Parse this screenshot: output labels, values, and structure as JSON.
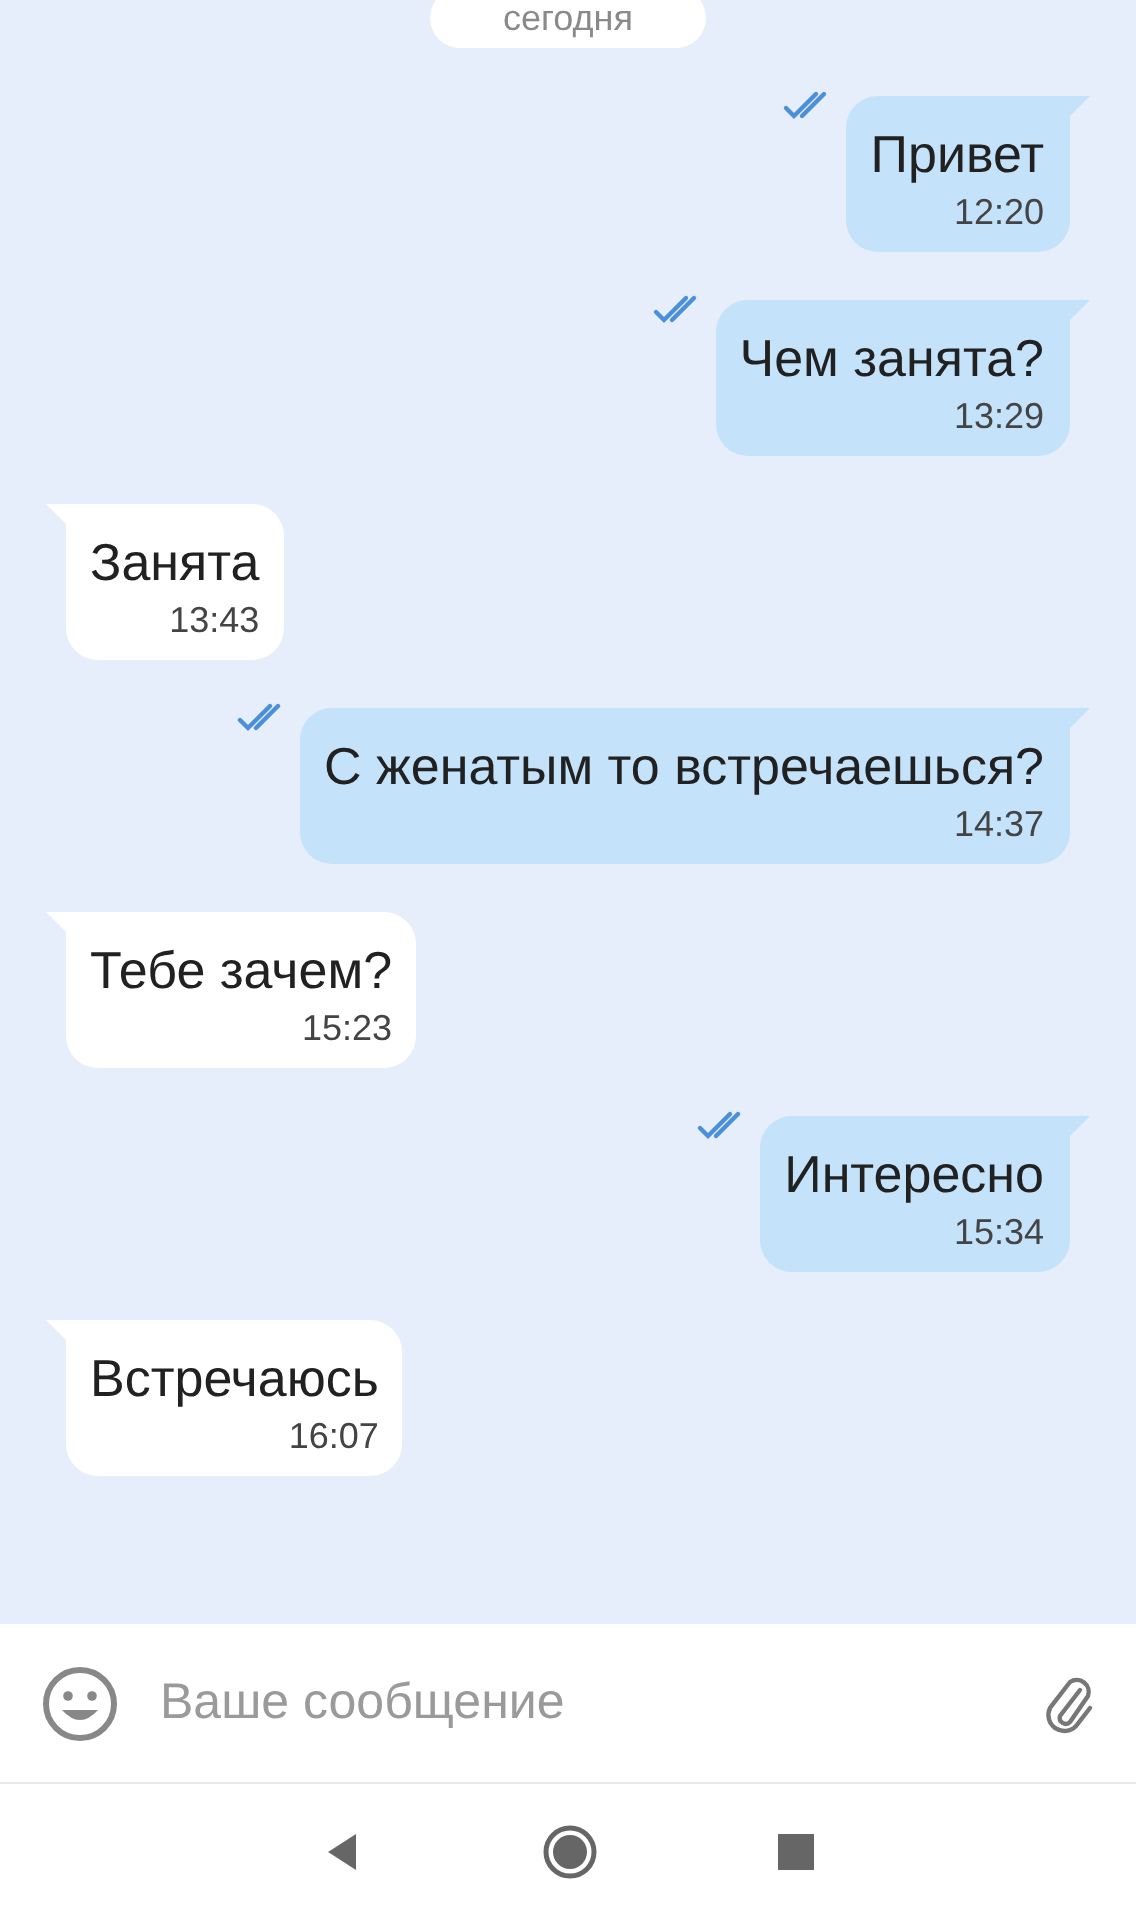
{
  "date_label": "сегодня",
  "messages": [
    {
      "kind": "outgoing",
      "text": "Привет",
      "time": "12:20",
      "read": true
    },
    {
      "kind": "outgoing",
      "text": "Чем занята?",
      "time": "13:29",
      "read": true
    },
    {
      "kind": "incoming",
      "text": "Занята",
      "time": "13:43"
    },
    {
      "kind": "outgoing",
      "text": "С женатым то встречаешься?",
      "time": "14:37",
      "read": true
    },
    {
      "kind": "incoming",
      "text": "Тебе зачем?",
      "time": "15:23"
    },
    {
      "kind": "outgoing",
      "text": "Интересно",
      "time": "15:34",
      "read": true
    },
    {
      "kind": "incoming",
      "text": "Встречаюсь",
      "time": "16:07"
    }
  ],
  "composer": {
    "placeholder": "Ваше сообщение"
  }
}
